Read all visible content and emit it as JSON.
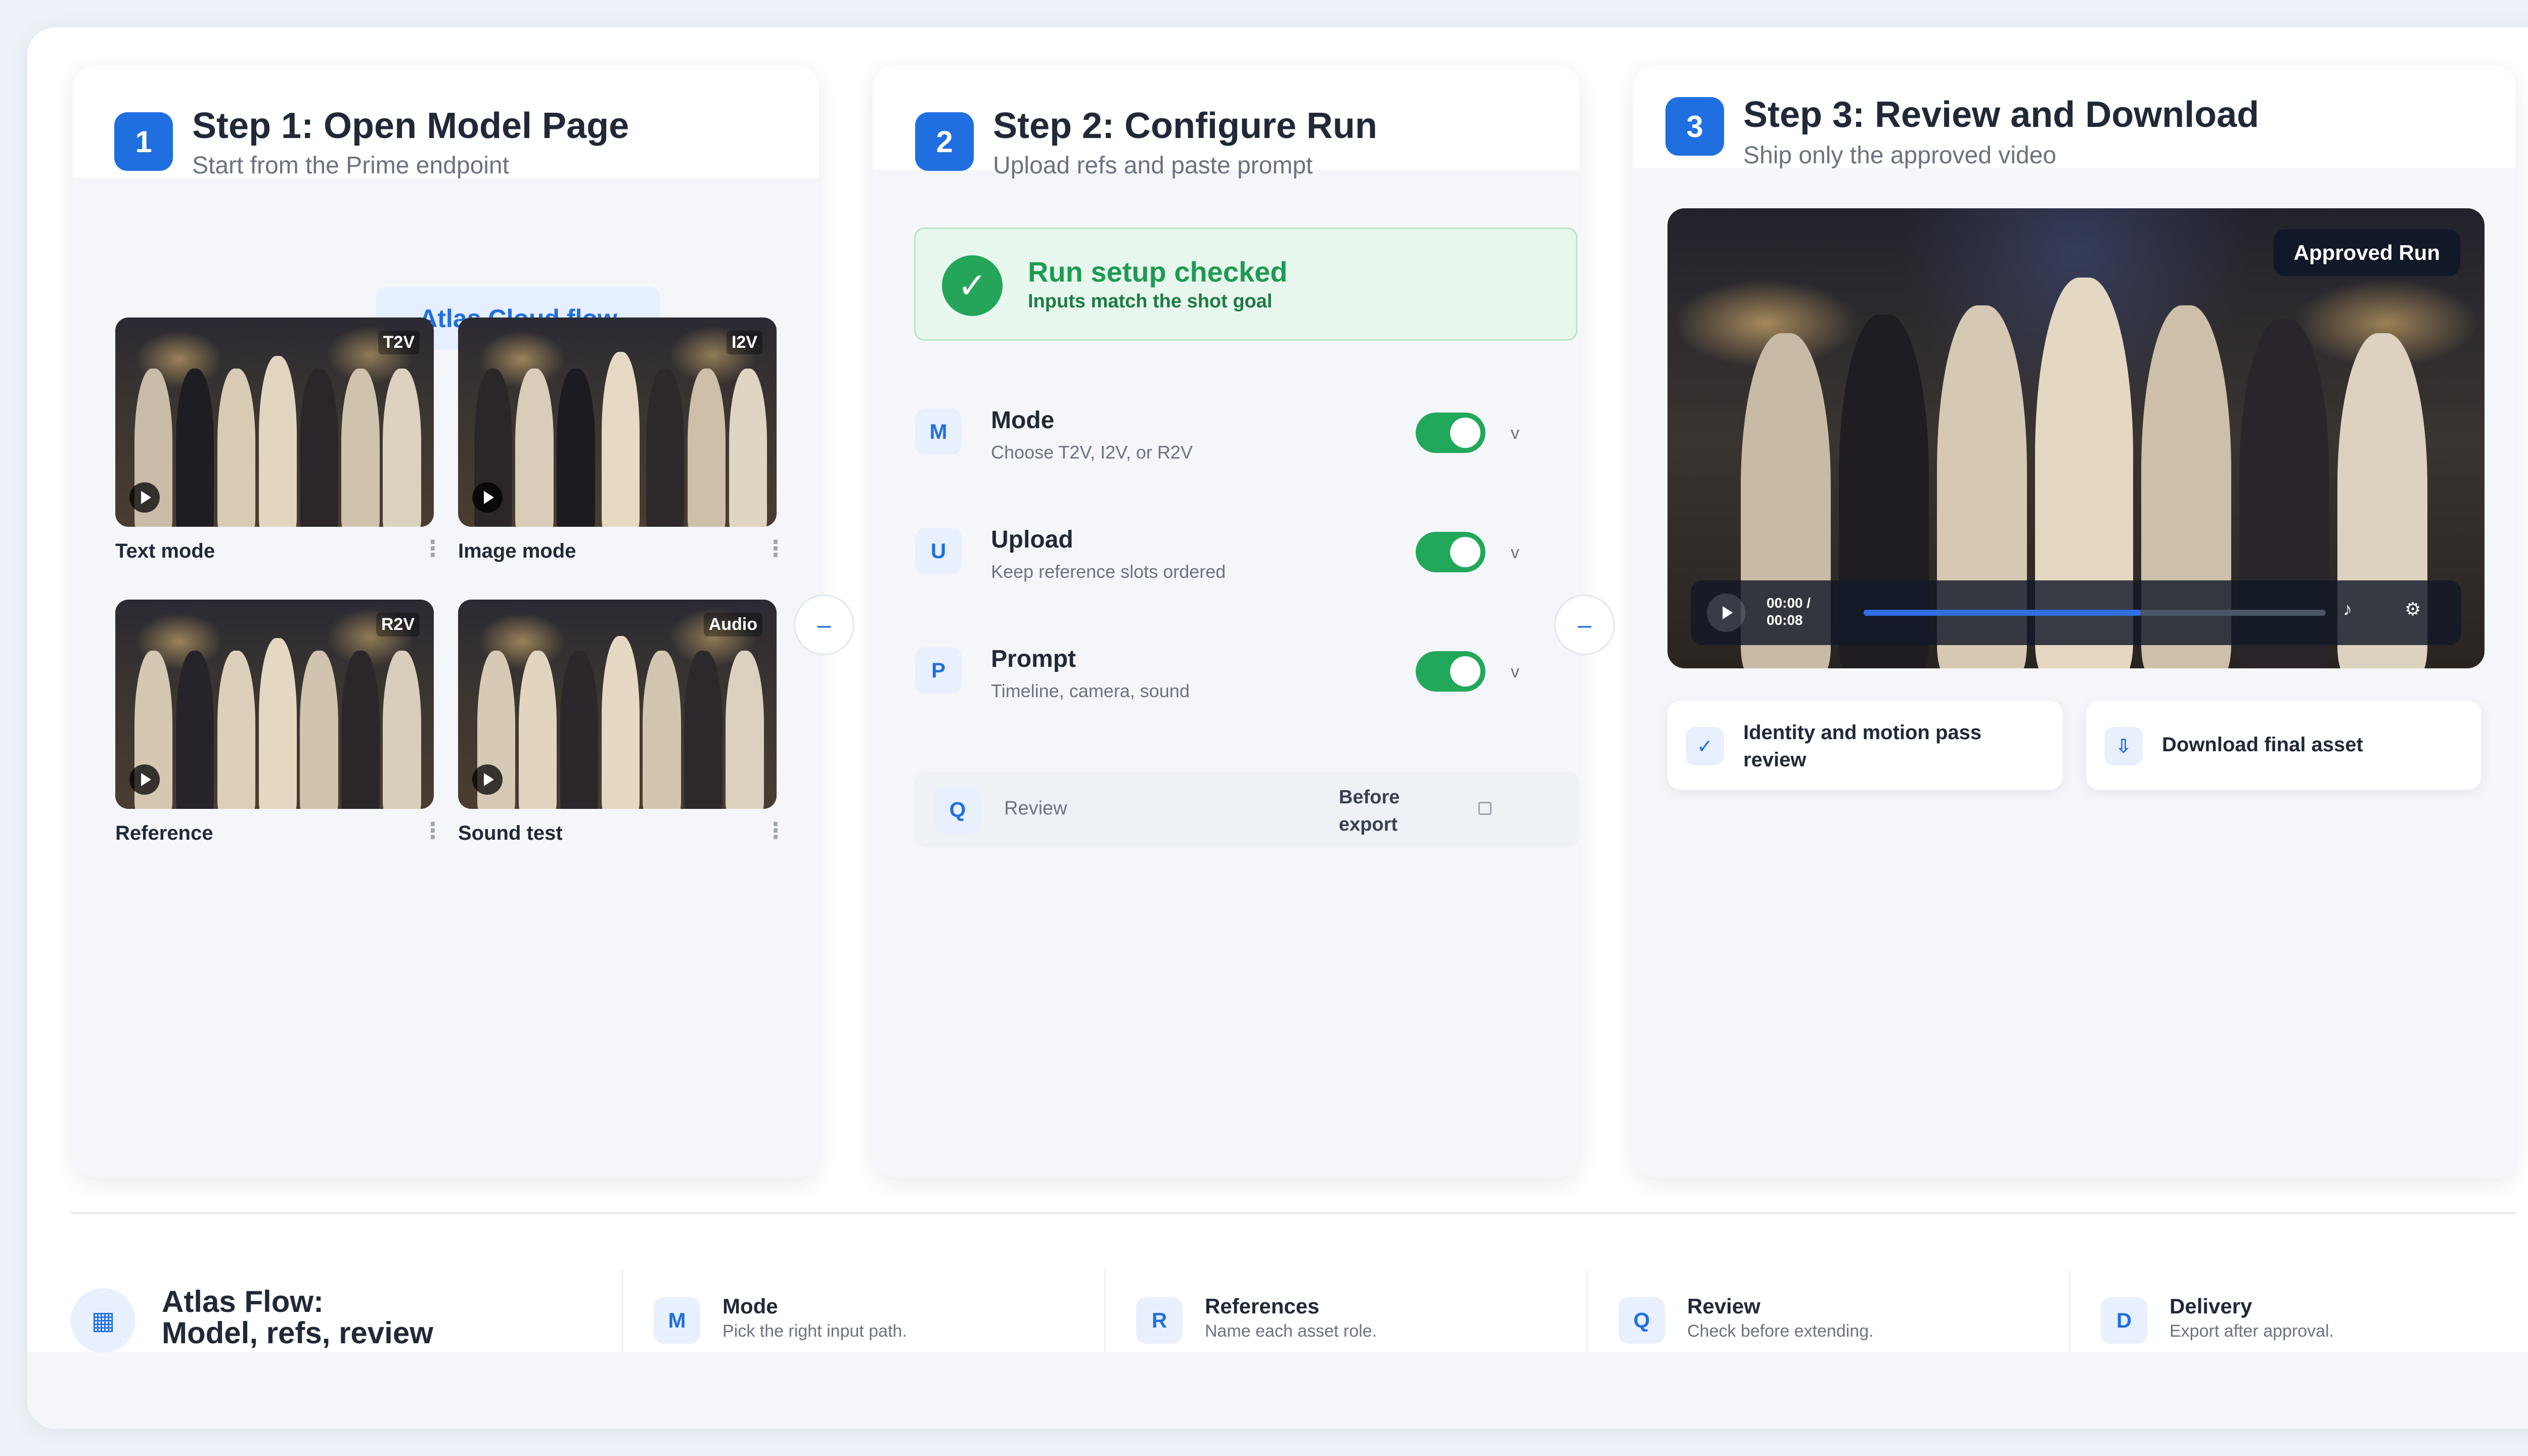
{
  "colors": {
    "accent": "#1f6fe0",
    "success": "#22a85b",
    "panel_bg": "#f5f6f9"
  },
  "steps": [
    {
      "number": "1",
      "title": "Step 1: Open Model Page",
      "subtitle": "Start from the Prime endpoint"
    },
    {
      "number": "2",
      "title": "Step 2: Configure Run",
      "subtitle": "Upload refs and paste prompt"
    },
    {
      "number": "3",
      "title": "Step 3: Review and Download",
      "subtitle": "Ship only the approved video"
    }
  ],
  "panel1": {
    "flow_button": "Atlas Cloud flow",
    "thumbnails": [
      {
        "badge": "T2V",
        "label": "Text mode"
      },
      {
        "badge": "I2V",
        "label": "Image mode"
      },
      {
        "badge": "R2V",
        "label": "Reference"
      },
      {
        "badge": "Audio",
        "label": "Sound test"
      }
    ],
    "kebab": "⋮",
    "side_control": "–"
  },
  "panel2": {
    "check": {
      "icon": "✓",
      "title": "Run setup checked",
      "subtitle": "Inputs match the shot goal"
    },
    "rows": [
      {
        "letter": "M",
        "title": "Mode",
        "subtitle": "Choose T2V, I2V, or R2V",
        "chevron": "v"
      },
      {
        "letter": "U",
        "title": "Upload",
        "subtitle": "Keep reference slots ordered",
        "chevron": "v"
      },
      {
        "letter": "P",
        "title": "Prompt",
        "subtitle": "Timeline, camera, sound",
        "chevron": "v"
      }
    ],
    "review": {
      "letter": "Q",
      "label": "Review",
      "right_line1": "Before",
      "right_line2": "export"
    },
    "side_control": "–"
  },
  "panel3": {
    "badge": "Approved Run",
    "player": {
      "time_current": "00:00 /",
      "time_total": "00:08",
      "progress": 0.6,
      "music_icon": "♪",
      "settings_icon": "⚙"
    },
    "actions": [
      {
        "icon": "✓",
        "line1": "Identity and motion pass",
        "line2": "review"
      },
      {
        "icon": "⇩",
        "line1": "Download final asset",
        "line2": ""
      }
    ]
  },
  "footer": {
    "icon": "▦",
    "title_line1": "Atlas Flow:",
    "title_line2": "Model, refs, review",
    "items": [
      {
        "letter": "M",
        "label": "Mode",
        "desc": "Pick the right input path."
      },
      {
        "letter": "R",
        "label": "References",
        "desc": "Name each asset role."
      },
      {
        "letter": "Q",
        "label": "Review",
        "desc": "Check before extending."
      },
      {
        "letter": "D",
        "label": "Delivery",
        "desc": "Export after approval."
      }
    ]
  }
}
